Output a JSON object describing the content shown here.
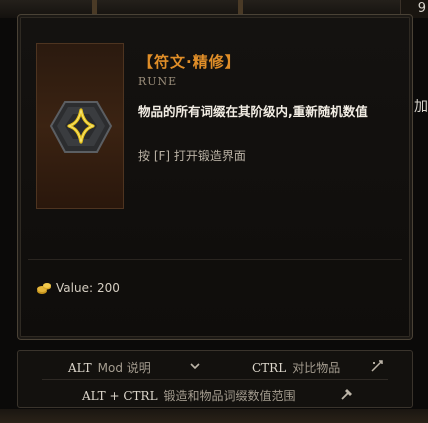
{
  "hud": {
    "corner_value": "9",
    "side_glyph": "加"
  },
  "item": {
    "name": "【符文·精修】",
    "type": "RUNE",
    "description": "物品的所有词缀在其阶级内,重新随机数值",
    "hint": "按 [F] 打开锻造界面",
    "value_label": "Value:",
    "value": "200"
  },
  "keybinds": [
    {
      "key": "ALT",
      "action": "Mod 说明",
      "icon": "chevron-down-icon"
    },
    {
      "key": "CTRL",
      "action": "对比物品",
      "icon": "compare-icon"
    },
    {
      "key": "ALT + CTRL",
      "action": "锻造和物品词缀数值范围",
      "icon": "hammer-icon"
    }
  ],
  "colors": {
    "title": "#e08e28",
    "rune_glow": "#e6c21a",
    "frame": "#4a4236"
  }
}
